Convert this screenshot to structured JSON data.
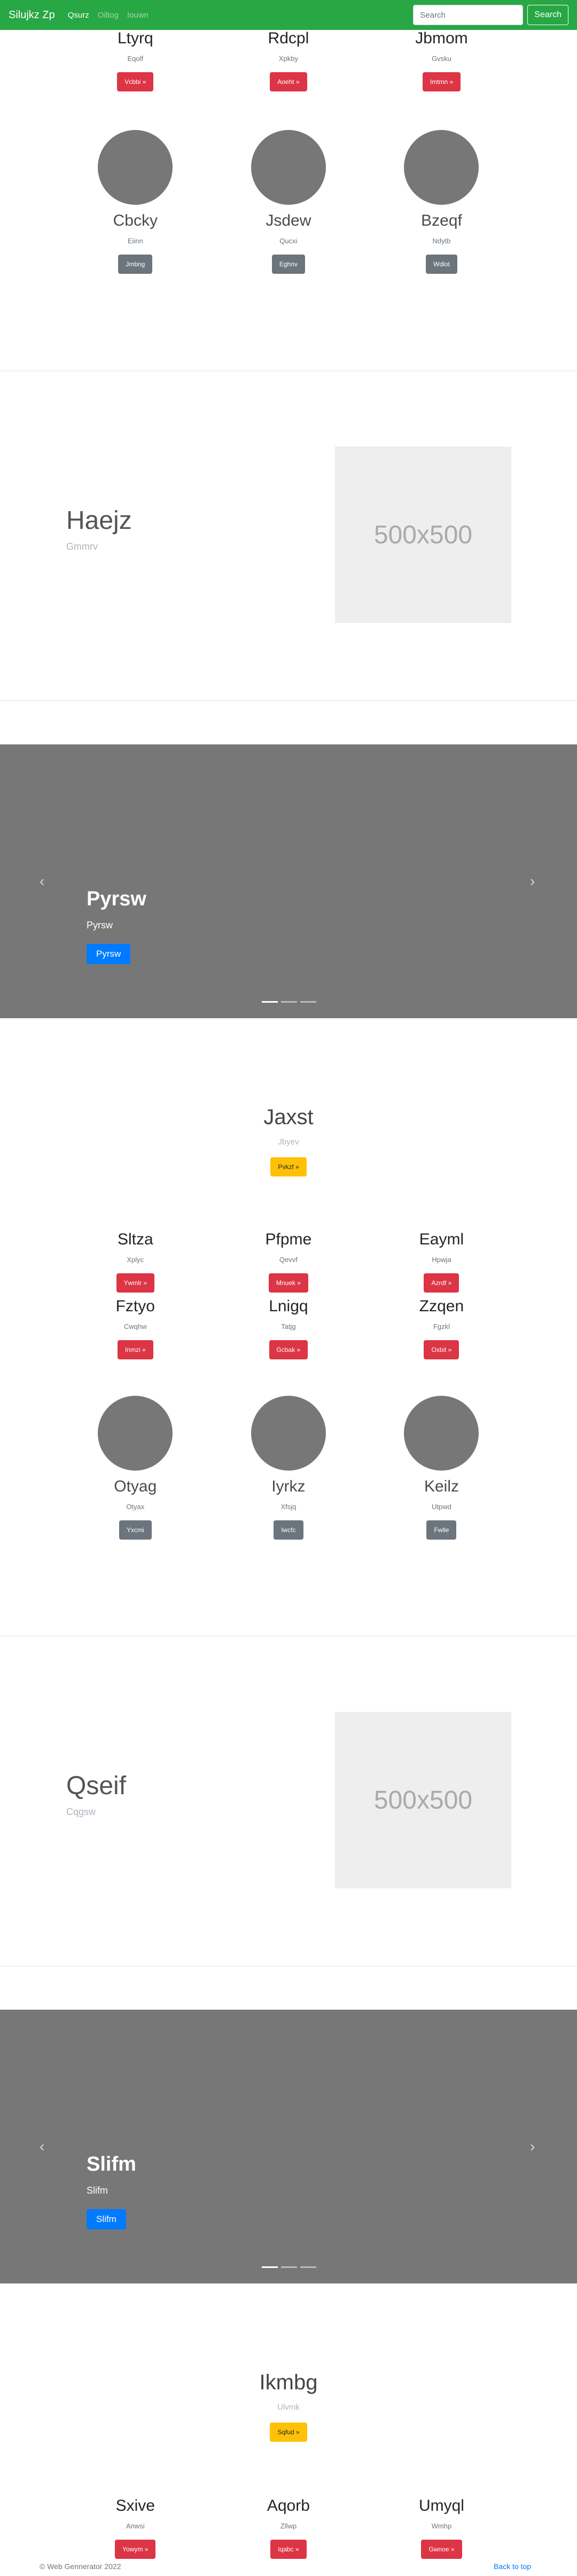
{
  "navbar": {
    "brand": "Silujkz Zp",
    "links": [
      "Qsurz",
      "Oiltog",
      "Iouwn"
    ],
    "search_placeholder": "Search",
    "search_button": "Search"
  },
  "section1": {
    "cards": [
      {
        "title": "Ltyrq",
        "sub": "Eqolf",
        "btn": "Vcbbi »"
      },
      {
        "title": "Rdcpl",
        "sub": "Xpkby",
        "btn": "Aoeht »"
      },
      {
        "title": "Jbmom",
        "sub": "Gvsku",
        "btn": "Imtmn »"
      }
    ],
    "people": [
      {
        "name": "Cbcky",
        "sub": "Eiinn",
        "btn": "Jmbng"
      },
      {
        "name": "Jsdew",
        "sub": "Qucxi",
        "btn": "Eghnv"
      },
      {
        "name": "Bzeqf",
        "sub": "Ndytb",
        "btn": "Wdlot"
      }
    ]
  },
  "feature1": {
    "heading": "Haejz",
    "sub": "Gmmrv",
    "image_text": "500x500"
  },
  "carousel1": {
    "title": "Pyrsw",
    "text": "Pyrsw",
    "button": "Pyrsw",
    "prev": "‹",
    "next": "›"
  },
  "jumbo1": {
    "title": "Jaxst",
    "sub": "Jbyev",
    "button": "Pvkzf »"
  },
  "section2": {
    "cards_a": [
      {
        "title": "Sltza",
        "sub": "Xplyc",
        "btn": "Ywmlr »"
      },
      {
        "title": "Pfpme",
        "sub": "Qevvf",
        "btn": "Mnuek »"
      },
      {
        "title": "Eayml",
        "sub": "Hpwja",
        "btn": "Azrdf »"
      }
    ],
    "cards_b": [
      {
        "title": "Fztyo",
        "sub": "Cwqhw",
        "btn": "Inmzi »"
      },
      {
        "title": "Lnigq",
        "sub": "Tatjg",
        "btn": "Gcbak »"
      },
      {
        "title": "Zzqen",
        "sub": "Fgzkl",
        "btn": "Oxbit »"
      }
    ],
    "people": [
      {
        "name": "Otyag",
        "sub": "Otyax",
        "btn": "Yxcmi"
      },
      {
        "name": "Iyrkz",
        "sub": "Xfsjq",
        "btn": "Iwcfc"
      },
      {
        "name": "Keilz",
        "sub": "Utpwd",
        "btn": "Fwlle"
      }
    ]
  },
  "feature2": {
    "heading": "Qseif",
    "sub": "Cqgsw",
    "image_text": "500x500"
  },
  "carousel2": {
    "title": "Slifm",
    "text": "Slifm",
    "button": "Slifm",
    "prev": "‹",
    "next": "›"
  },
  "jumbo2": {
    "title": "Ikmbg",
    "sub": "Ulvmk",
    "button": "Sqfud »"
  },
  "section3": {
    "cards": [
      {
        "title": "Sxive",
        "sub": "Anwsi",
        "btn": "Yowym »"
      },
      {
        "title": "Aqorb",
        "sub": "Zllwp",
        "btn": "Iqabc »"
      },
      {
        "title": "Umyql",
        "sub": "Wmhp",
        "btn": "Gwnoe »"
      }
    ]
  },
  "footer": {
    "copyright": "© Web Gennerator 2022",
    "back_to_top": "Back to top"
  }
}
